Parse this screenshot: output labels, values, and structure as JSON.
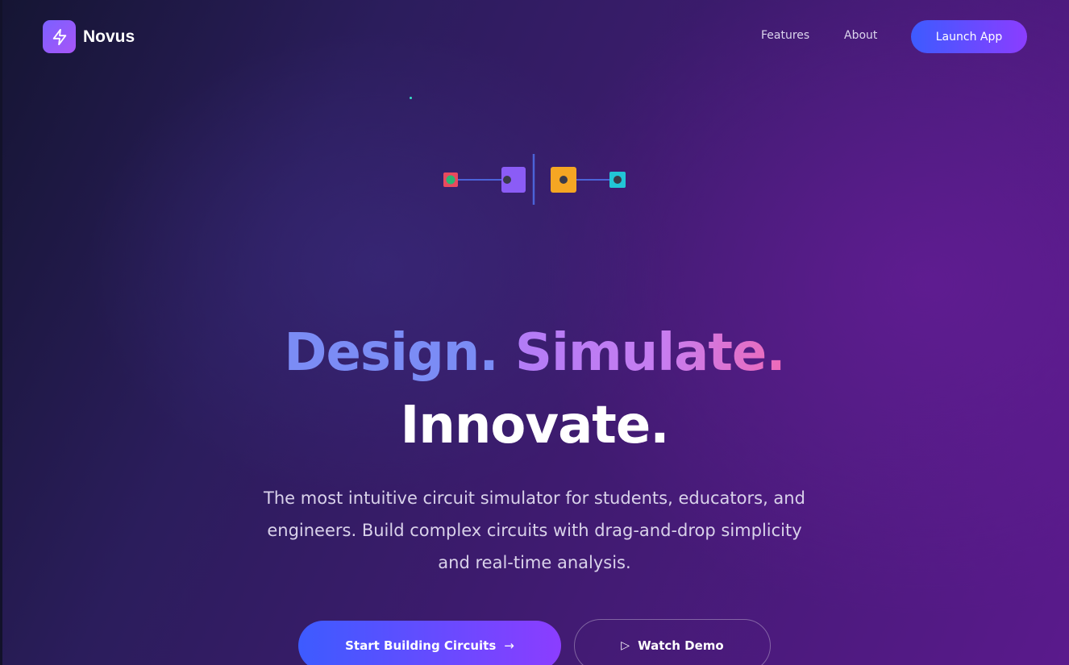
{
  "brand": {
    "name": "Novus",
    "logo_icon": "lightning-bolt-icon"
  },
  "nav": {
    "links": [
      {
        "label": "Features"
      },
      {
        "label": "About"
      }
    ],
    "launch_label": "Launch App"
  },
  "hero": {
    "headline": {
      "word1": "Design.",
      "word2": "Simulate.",
      "word3": "Innovate."
    },
    "subtitle": {
      "line1": "The most intuitive circuit simulator for students, educators, and",
      "line2": "engineers. Build complex circuits with drag-and-drop simplicity",
      "line3": "and real-time analysis."
    },
    "cta_primary": {
      "label": "Start Building Circuits",
      "icon": "arrow-right-icon"
    },
    "cta_secondary": {
      "label": "Watch Demo",
      "icon": "play-icon"
    }
  },
  "colors": {
    "accent_blue": "#3d5bff",
    "accent_purple": "#8b3dff",
    "design_text": "#7b8cf5",
    "simulate_start": "#b27cf7",
    "simulate_end": "#ee6ab8",
    "circuit_red": "#e84a5f",
    "circuit_green": "#2bb673",
    "circuit_purple": "#8b5cf6",
    "circuit_orange": "#f5a623",
    "circuit_cyan": "#22c5d6"
  }
}
